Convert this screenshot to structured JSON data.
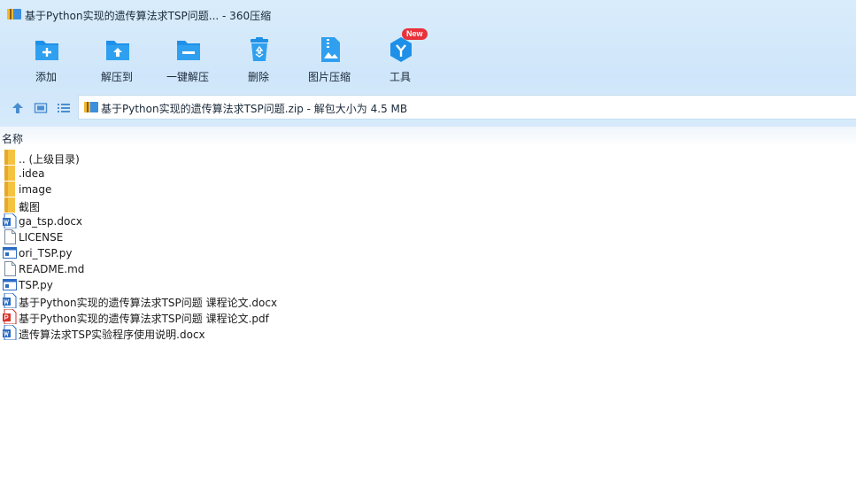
{
  "window": {
    "title": "基于Python实现的遗传算法求TSP问题... - 360压缩"
  },
  "toolbar": {
    "buttons": [
      {
        "id": "add",
        "label": "添加",
        "icon": "add-folder-icon"
      },
      {
        "id": "extract-to",
        "label": "解压到",
        "icon": "extract-folder-icon"
      },
      {
        "id": "one-click-extract",
        "label": "一键解压",
        "icon": "quick-extract-folder-icon"
      },
      {
        "id": "delete",
        "label": "删除",
        "icon": "recycle-bin-icon"
      },
      {
        "id": "image-compress",
        "label": "图片压缩",
        "icon": "image-zip-icon"
      },
      {
        "id": "tools",
        "label": "工具",
        "icon": "tools-hexagon-icon"
      }
    ],
    "new_badge": "New"
  },
  "address": {
    "text": "基于Python实现的遗传算法求TSP问题.zip - 解包大小为 4.5 MB"
  },
  "columns": {
    "name": "名称"
  },
  "files": [
    {
      "name": ".. (上级目录)",
      "type": "folder"
    },
    {
      "name": ".idea",
      "type": "folder"
    },
    {
      "name": "image",
      "type": "folder"
    },
    {
      "name": "截图",
      "type": "folder"
    },
    {
      "name": "ga_tsp.docx",
      "type": "word"
    },
    {
      "name": "LICENSE",
      "type": "file"
    },
    {
      "name": "ori_TSP.py",
      "type": "python"
    },
    {
      "name": "README.md",
      "type": "file"
    },
    {
      "name": "TSP.py",
      "type": "python"
    },
    {
      "name": "基于Python实现的遗传算法求TSP问题 课程论文.docx",
      "type": "word"
    },
    {
      "name": "基于Python实现的遗传算法求TSP问题 课程论文.pdf",
      "type": "pdf"
    },
    {
      "name": "遗传算法求TSP实验程序使用说明.docx",
      "type": "word"
    }
  ],
  "colors": {
    "accent": "#1e90e8",
    "chrome_bg": "#d4e8fa",
    "folder": "#f5c342",
    "badge": "#e8313a"
  }
}
